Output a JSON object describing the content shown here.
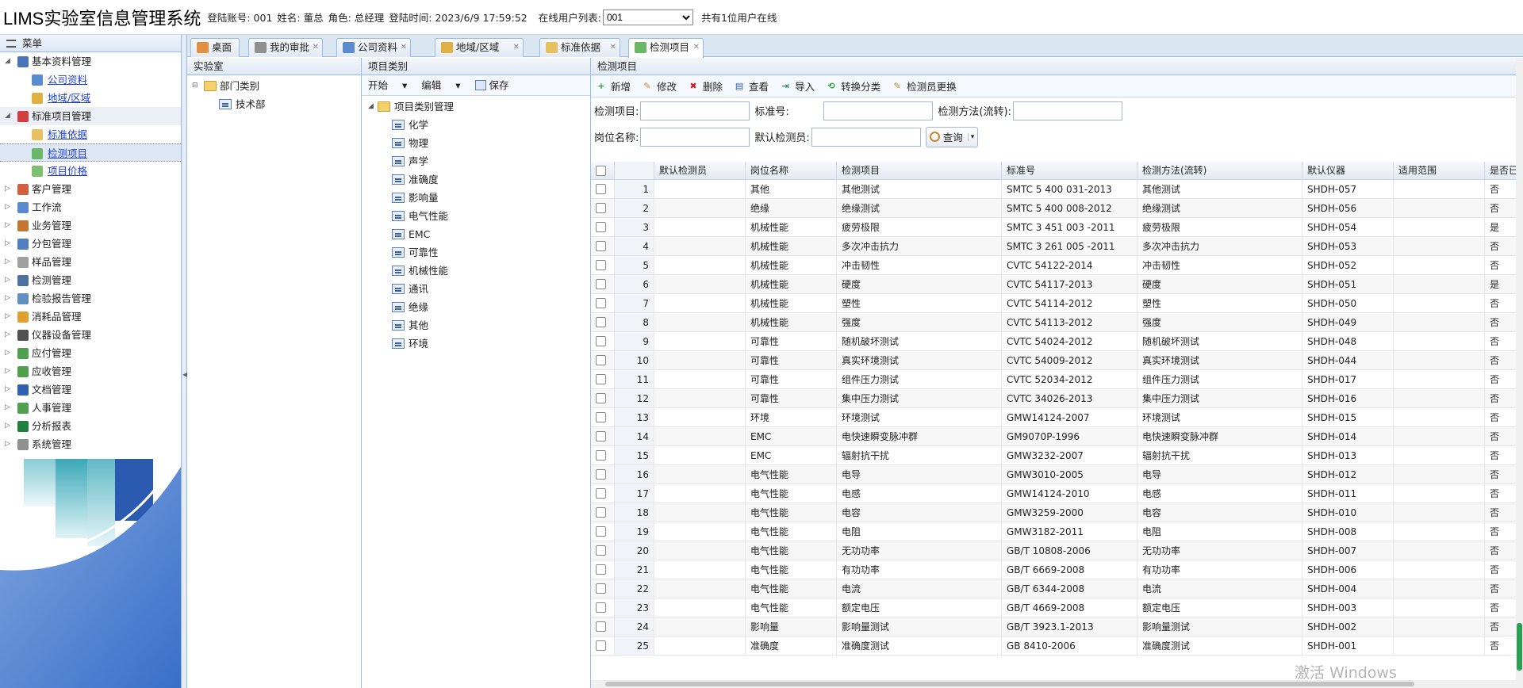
{
  "header": {
    "app_title": "LIMS实验室信息管理系统",
    "login_account": "登陆账号: 001",
    "user_name": "姓名: 董总",
    "role": "角色: 总经理",
    "login_time": "登陆时间: 2023/6/9 17:59:52",
    "online_label": "在线用户列表:",
    "online_selected": "001",
    "online_count": "共有1位用户在线"
  },
  "menu": {
    "title": "菜单",
    "items": [
      {
        "label": "基本资料管理",
        "level": 1,
        "arrow": "◢",
        "icon": "book-icon",
        "color": "#4a76b8"
      },
      {
        "label": "公司资料",
        "level": 2,
        "icon": "edit-doc-icon",
        "color": "#5a8ad0"
      },
      {
        "label": "地域/区域",
        "level": 2,
        "icon": "map-icon",
        "color": "#e0b040"
      },
      {
        "label": "标准项目管理",
        "level": 1,
        "arrow": "◢",
        "icon": "screen-icon",
        "color": "#d04040"
      },
      {
        "label": "标准依据",
        "level": 2,
        "icon": "folder-doc-icon",
        "color": "#e8c060"
      },
      {
        "label": "检测项目",
        "level": 2,
        "icon": "import-icon",
        "color": "#68b868"
      },
      {
        "label": "项目价格",
        "level": 2,
        "icon": "price-icon",
        "color": "#7cc070"
      },
      {
        "label": "客户管理",
        "level": 1,
        "arrow": "▷",
        "icon": "user-icon",
        "color": "#d06040"
      },
      {
        "label": "工作流",
        "level": 1,
        "arrow": "▷",
        "icon": "flow-icon",
        "color": "#5a8ad0"
      },
      {
        "label": "业务管理",
        "level": 1,
        "arrow": "▷",
        "icon": "clipboard-icon",
        "color": "#c07830"
      },
      {
        "label": "分包管理",
        "level": 1,
        "arrow": "▷",
        "icon": "package-icon",
        "color": "#5080c0"
      },
      {
        "label": "样品管理",
        "level": 1,
        "arrow": "▷",
        "icon": "cube-icon",
        "color": "#a0a0a0"
      },
      {
        "label": "检测管理",
        "level": 1,
        "arrow": "▷",
        "icon": "monitor-icon",
        "color": "#5070a0"
      },
      {
        "label": "检验报告管理",
        "level": 1,
        "arrow": "▷",
        "icon": "report-icon",
        "color": "#6090c0"
      },
      {
        "label": "消耗品管理",
        "level": 1,
        "arrow": "▷",
        "icon": "box-icon",
        "color": "#e0a030"
      },
      {
        "label": "仪器设备管理",
        "level": 1,
        "arrow": "▷",
        "icon": "camera-icon",
        "color": "#505050"
      },
      {
        "label": "应付管理",
        "level": 1,
        "arrow": "▷",
        "icon": "payable-icon",
        "color": "#50a050"
      },
      {
        "label": "应收管理",
        "level": 1,
        "arrow": "▷",
        "icon": "receivable-icon",
        "color": "#50a050"
      },
      {
        "label": "文档管理",
        "level": 1,
        "arrow": "▷",
        "icon": "word-doc-icon",
        "color": "#3060b0"
      },
      {
        "label": "人事管理",
        "level": 1,
        "arrow": "▷",
        "icon": "people-icon",
        "color": "#50a050"
      },
      {
        "label": "分析报表",
        "level": 1,
        "arrow": "▷",
        "icon": "excel-icon",
        "color": "#208040"
      },
      {
        "label": "系统管理",
        "level": 1,
        "arrow": "▷",
        "icon": "gear-icon",
        "color": "#909090"
      }
    ]
  },
  "tabs": [
    {
      "label": "桌面",
      "icon": "home-icon",
      "color": "#e09040"
    },
    {
      "label": "我的审批",
      "icon": "approval-icon",
      "color": "#909090"
    },
    {
      "label": "公司资料",
      "icon": "edit-doc-icon",
      "color": "#5a8ad0"
    },
    {
      "label": "地域/区域",
      "icon": "map-icon",
      "color": "#e0b040"
    },
    {
      "label": "标准依据",
      "icon": "folder-doc-icon",
      "color": "#e8c060"
    },
    {
      "label": "检测项目",
      "icon": "import-icon",
      "color": "#68b868"
    }
  ],
  "lab_panel": {
    "title": "实验室",
    "root": "部门类别",
    "child": "技术部"
  },
  "category_panel": {
    "title": "项目类别",
    "toolbar": {
      "start": "开始",
      "edit": "编辑",
      "save": "保存"
    },
    "root": "项目类别管理",
    "children": [
      "化学",
      "物理",
      "声学",
      "准确度",
      "影响量",
      "电气性能",
      "EMC",
      "可靠性",
      "机械性能",
      "通讯",
      "绝缘",
      "其他",
      "环境"
    ]
  },
  "items_panel": {
    "title": "检测项目",
    "toolbar": [
      {
        "label": "新增",
        "icon": "add-icon",
        "color": "#2e9e3e",
        "glyph": "+"
      },
      {
        "label": "修改",
        "icon": "edit-icon",
        "color": "#c08a30",
        "glyph": "✎"
      },
      {
        "label": "删除",
        "icon": "delete-icon",
        "color": "#d02020",
        "glyph": "✖"
      },
      {
        "label": "查看",
        "icon": "view-icon",
        "color": "#3a62a8",
        "glyph": "▤"
      },
      {
        "label": "导入",
        "icon": "import-icon",
        "color": "#3a8a6a",
        "glyph": "⇥"
      },
      {
        "label": "转换分类",
        "icon": "convert-icon",
        "color": "#2e9e3e",
        "glyph": "⟲"
      },
      {
        "label": "检测员更换",
        "icon": "swap-icon",
        "color": "#c08a30",
        "glyph": "✎"
      }
    ],
    "filters": {
      "item_label": "检测项目:",
      "std_label": "标准号:",
      "method_label": "检测方法(流转):",
      "post_label": "岗位名称:",
      "inspector_label": "默认检测员:",
      "query_label": "查询"
    },
    "columns": [
      "默认检测员",
      "岗位名称",
      "检测项目",
      "标准号",
      "检测方法(流转)",
      "默认仪器",
      "适用范围",
      "是否已"
    ],
    "rows": [
      [
        "1",
        "",
        "其他",
        "其他测试",
        "SMTC 5 400 031-2013",
        "其他测试",
        "SHDH-057",
        "",
        "否"
      ],
      [
        "2",
        "",
        "绝缘",
        "绝缘测试",
        "SMTC 5 400 008-2012",
        "绝缘测试",
        "SHDH-056",
        "",
        "否"
      ],
      [
        "3",
        "",
        "机械性能",
        "疲劳极限",
        "SMTC 3 451 003 -2011",
        "疲劳极限",
        "SHDH-054",
        "",
        "是"
      ],
      [
        "4",
        "",
        "机械性能",
        "多次冲击抗力",
        "SMTC 3 261 005 -2011",
        "多次冲击抗力",
        "SHDH-053",
        "",
        "否"
      ],
      [
        "5",
        "",
        "机械性能",
        "冲击韧性",
        "CVTC 54122-2014",
        "冲击韧性",
        "SHDH-052",
        "",
        "否"
      ],
      [
        "6",
        "",
        "机械性能",
        "硬度",
        "CVTC 54117-2013",
        "硬度",
        "SHDH-051",
        "",
        "是"
      ],
      [
        "7",
        "",
        "机械性能",
        "塑性",
        "CVTC 54114-2012",
        "塑性",
        "SHDH-050",
        "",
        "否"
      ],
      [
        "8",
        "",
        "机械性能",
        "强度",
        "CVTC 54113-2012",
        "强度",
        "SHDH-049",
        "",
        "否"
      ],
      [
        "9",
        "",
        "可靠性",
        "随机破坏测试",
        "CVTC 54024-2012",
        "随机破坏测试",
        "SHDH-048",
        "",
        "否"
      ],
      [
        "10",
        "",
        "可靠性",
        "真实环境测试",
        "CVTC 54009-2012",
        "真实环境测试",
        "SHDH-044",
        "",
        "否"
      ],
      [
        "11",
        "",
        "可靠性",
        "组件压力测试",
        "CVTC 52034-2012",
        "组件压力测试",
        "SHDH-017",
        "",
        "否"
      ],
      [
        "12",
        "",
        "可靠性",
        "集中压力测试",
        "CVTC 34026-2013",
        "集中压力测试",
        "SHDH-016",
        "",
        "否"
      ],
      [
        "13",
        "",
        "环境",
        "环境测试",
        "GMW14124-2007",
        "环境测试",
        "SHDH-015",
        "",
        "否"
      ],
      [
        "14",
        "",
        "EMC",
        "电快速瞬变脉冲群",
        "GM9070P-1996",
        "电快速瞬变脉冲群",
        "SHDH-014",
        "",
        "否"
      ],
      [
        "15",
        "",
        "EMC",
        "辐射抗干扰",
        "GMW3232-2007",
        "辐射抗干扰",
        "SHDH-013",
        "",
        "否"
      ],
      [
        "16",
        "",
        "电气性能",
        "电导",
        "GMW3010-2005",
        "电导",
        "SHDH-012",
        "",
        "否"
      ],
      [
        "17",
        "",
        "电气性能",
        "电感",
        "GMW14124-2010",
        "电感",
        "SHDH-011",
        "",
        "否"
      ],
      [
        "18",
        "",
        "电气性能",
        "电容",
        "GMW3259-2000",
        "电容",
        "SHDH-010",
        "",
        "否"
      ],
      [
        "19",
        "",
        "电气性能",
        "电阻",
        "GMW3182-2011",
        "电阻",
        "SHDH-008",
        "",
        "否"
      ],
      [
        "20",
        "",
        "电气性能",
        "无功功率",
        "GB/T 10808-2006",
        "无功功率",
        "SHDH-007",
        "",
        "否"
      ],
      [
        "21",
        "",
        "电气性能",
        "有功功率",
        "GB/T 6669-2008",
        "有功功率",
        "SHDH-006",
        "",
        "否"
      ],
      [
        "22",
        "",
        "电气性能",
        "电流",
        "GB/T 6344-2008",
        "电流",
        "SHDH-004",
        "",
        "否"
      ],
      [
        "23",
        "",
        "电气性能",
        "额定电压",
        "GB/T 4669-2008",
        "额定电压",
        "SHDH-003",
        "",
        "否"
      ],
      [
        "24",
        "",
        "影响量",
        "影响量测试",
        "GB/T 3923.1-2013",
        "影响量测试",
        "SHDH-002",
        "",
        "否"
      ],
      [
        "25",
        "",
        "准确度",
        "准确度测试",
        "GB 8410-2006",
        "准确度测试",
        "SHDH-001",
        "",
        "否"
      ]
    ]
  },
  "watermark": "激活 Windows"
}
